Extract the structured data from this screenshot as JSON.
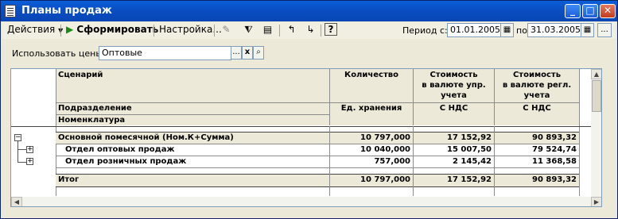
{
  "window": {
    "title": "Планы продаж"
  },
  "toolbar": {
    "actions_label": "Действия",
    "form_label": "Сформировать",
    "settings_label": "Настройка...",
    "period_from_label": "Период с:",
    "period_from": "01.01.2005",
    "period_to_label": "по",
    "period_to": "31.03.2005",
    "more_label": "..."
  },
  "prices": {
    "label": "Использовать цены:",
    "value": "Оптовые",
    "select_label": "...",
    "clear_label": "x"
  },
  "report": {
    "headers": {
      "scenario": "Сценарий",
      "department": "Подразделение",
      "nomenclature": "Номенклатура",
      "qty": "Количество",
      "unit": "Ед. хранения",
      "cost_mgmt": [
        "Стоимость",
        "в валюте упр.",
        "учета"
      ],
      "cost_mgmt_sub": "С НДС",
      "cost_reg": [
        "Стоимость",
        "в валюте регл.",
        "учета"
      ],
      "cost_reg_sub": "С НДС"
    },
    "rows": [
      {
        "name": "Основной помесячной (Ном.К+Сумма)",
        "qty": "10 797,000",
        "cost_mgmt": "17 152,92",
        "cost_reg": "90 893,32"
      },
      {
        "name": "Отдел оптовых продаж",
        "qty": "10 040,000",
        "cost_mgmt": "15 007,50",
        "cost_reg": "79 524,74"
      },
      {
        "name": "Отдел розничных продаж",
        "qty": "757,000",
        "cost_mgmt": "2 145,42",
        "cost_reg": "11 368,58"
      }
    ],
    "total": {
      "name": "Итог",
      "qty": "10 797,000",
      "cost_mgmt": "17 152,92",
      "cost_reg": "90 893,32"
    }
  }
}
